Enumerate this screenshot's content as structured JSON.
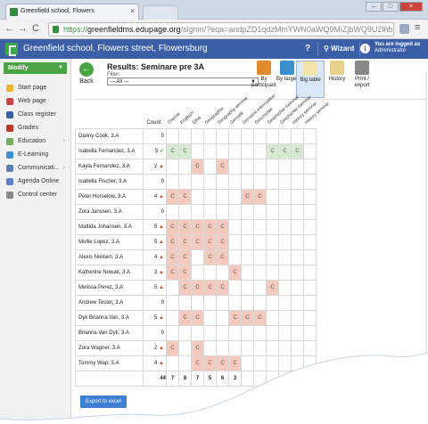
{
  "browser": {
    "tab_title": "Greenfield school, Flowers",
    "url_scheme": "https://",
    "url_host": "greenfieldms.edupage.org",
    "url_path": "/signin/?eqa=andpZD1qdzMmYWN0aWQ9MiZjbWQ9U2lnbmluQWN0aW9u"
  },
  "header": {
    "school_name": "Greenfield school, Flowers street, Flowersburg",
    "help": "?",
    "wizard": "Wizard",
    "info": "i",
    "logged_as_label": "You are logged as",
    "logged_as_user": "Administrator"
  },
  "sidebar": {
    "modify_label": "Modify",
    "items": [
      {
        "label": "Start page",
        "icon": "star-icon",
        "color": "#f0b429"
      },
      {
        "label": "Web page",
        "icon": "globe-icon",
        "color": "#c44"
      },
      {
        "label": "Class register",
        "icon": "book-icon",
        "color": "#3b5fa6"
      },
      {
        "label": "Grades",
        "icon": "grades-icon",
        "color": "#c0392b"
      },
      {
        "label": "Education",
        "icon": "education-icon",
        "color": "#7a5"
      },
      {
        "label": "E-Learning",
        "icon": "elearning-icon",
        "color": "#3b8fd1"
      },
      {
        "label": "Communicati...",
        "icon": "communication-icon",
        "color": "#5a7fb4"
      },
      {
        "label": "Agenda Online",
        "icon": "pen-icon",
        "color": "#5b82c5"
      },
      {
        "label": "Control center",
        "icon": "gear-icon",
        "color": "#888"
      }
    ]
  },
  "toolbar": {
    "back": "Back",
    "title": "Results: Seminare pre 3A",
    "filter_label": "Filter:",
    "filter_value": "--- All ---",
    "buttons": [
      {
        "label": "By participant",
        "color": "#e08a2a"
      },
      {
        "label": "By target",
        "color": "#3b8fd1"
      },
      {
        "label": "Big table",
        "color": "#f3e3a8"
      },
      {
        "label": "History",
        "color": "#e6d08a"
      },
      {
        "label": "Print / export",
        "color": "#888"
      }
    ]
  },
  "table": {
    "count_header": "Count",
    "subjects": [
      "Chemie",
      "Englisch",
      "Ethik",
      "Geographie",
      "Geography seminar",
      "Gematik",
      "Gemeine Informatiker",
      "Geschichte",
      "Geschichte-Seminar",
      "Geschichte-Seminar",
      "History seminar",
      "History seminar"
    ],
    "rows": [
      {
        "name": "Danny Cook, 3.A",
        "count": "0",
        "status": "",
        "cells": [
          "",
          "",
          "",
          "",
          "",
          "",
          "",
          "",
          "",
          "",
          "",
          ""
        ]
      },
      {
        "name": "Isabella Fernandez, 3.A",
        "count": "5",
        "status": "ok",
        "cells": [
          "g",
          "g",
          "",
          "",
          "",
          "",
          "",
          "",
          "g",
          "g",
          "g",
          ""
        ]
      },
      {
        "name": "Kayla Fernandez, 3.A",
        "count": "2",
        "status": "warn",
        "cells": [
          "",
          "",
          "r",
          "",
          "r",
          "",
          "",
          "",
          "",
          "",
          "",
          ""
        ]
      },
      {
        "name": "Isabella Fischer, 3.A",
        "count": "0",
        "status": "",
        "cells": [
          "",
          "",
          "",
          "",
          "",
          "",
          "",
          "",
          "",
          "",
          "",
          ""
        ]
      },
      {
        "name": "Peter Horselow, 3.A",
        "count": "4",
        "status": "warn",
        "cells": [
          "r",
          "r",
          "",
          "",
          "",
          "",
          "r",
          "r",
          "",
          "",
          "",
          ""
        ]
      },
      {
        "name": "Zora Janssen, 3.A",
        "count": "0",
        "status": "",
        "cells": [
          "",
          "",
          "",
          "",
          "",
          "",
          "",
          "",
          "",
          "",
          "",
          ""
        ]
      },
      {
        "name": "Mattida Johansen, 3.A",
        "count": "5",
        "status": "warn",
        "cells": [
          "r",
          "r",
          "r",
          "r",
          "r",
          "",
          "",
          "",
          "",
          "",
          "",
          ""
        ]
      },
      {
        "name": "Mollie Lopez, 3.A",
        "count": "5",
        "status": "warn",
        "cells": [
          "r",
          "r",
          "r",
          "r",
          "r",
          "",
          "",
          "",
          "",
          "",
          "",
          ""
        ]
      },
      {
        "name": "Alexis Nielsen, 3.A",
        "count": "4",
        "status": "warn",
        "cells": [
          "r",
          "r",
          "",
          "r",
          "r",
          "",
          "",
          "",
          "",
          "",
          "",
          ""
        ]
      },
      {
        "name": "Katherine Nowak, 3.A",
        "count": "3",
        "status": "warn",
        "cells": [
          "r",
          "r",
          "",
          "",
          "",
          "r",
          "",
          "",
          "",
          "",
          "",
          ""
        ]
      },
      {
        "name": "Melissa Perez, 3.A",
        "count": "5",
        "status": "warn",
        "cells": [
          "",
          "r",
          "r",
          "r",
          "r",
          "",
          "",
          "",
          "r",
          "",
          "",
          ""
        ]
      },
      {
        "name": "Andrew Tester, 3.A",
        "count": "0",
        "status": "",
        "cells": [
          "",
          "",
          "",
          "",
          "",
          "",
          "",
          "",
          "",
          "",
          "",
          ""
        ]
      },
      {
        "name": "Dyk Brianna Van, 3.A",
        "count": "5",
        "status": "warn",
        "cells": [
          "",
          "r",
          "r",
          "",
          "",
          "r",
          "r",
          "r",
          "",
          "",
          "",
          ""
        ]
      },
      {
        "name": "Brianna Van Dyk, 3.A",
        "count": "0",
        "status": "",
        "cells": [
          "",
          "",
          "",
          "",
          "",
          "",
          "",
          "",
          "",
          "",
          "",
          ""
        ]
      },
      {
        "name": "Zora Wagner, 3.A",
        "count": "2",
        "status": "warn",
        "cells": [
          "r",
          "",
          "r",
          "",
          "",
          "",
          "",
          "",
          "",
          "",
          "",
          ""
        ]
      },
      {
        "name": "Tommy Wap, 3.A",
        "count": "4",
        "status": "warn",
        "cells": [
          "",
          "",
          "r",
          "r",
          "r",
          "r",
          "",
          "",
          "",
          "",
          "",
          ""
        ]
      }
    ],
    "cell_letter": "C",
    "totals": [
      "44",
      "7",
      "8",
      "7",
      "5",
      "6",
      "3",
      "",
      "",
      "",
      "",
      "",
      ""
    ]
  },
  "export_label": "Export to excel",
  "colors": {
    "ok_cell": "#d7ebd3",
    "warn_cell": "#f6c9bd",
    "header_blue": "#3b5fa6",
    "modify_green": "#4aa444"
  }
}
